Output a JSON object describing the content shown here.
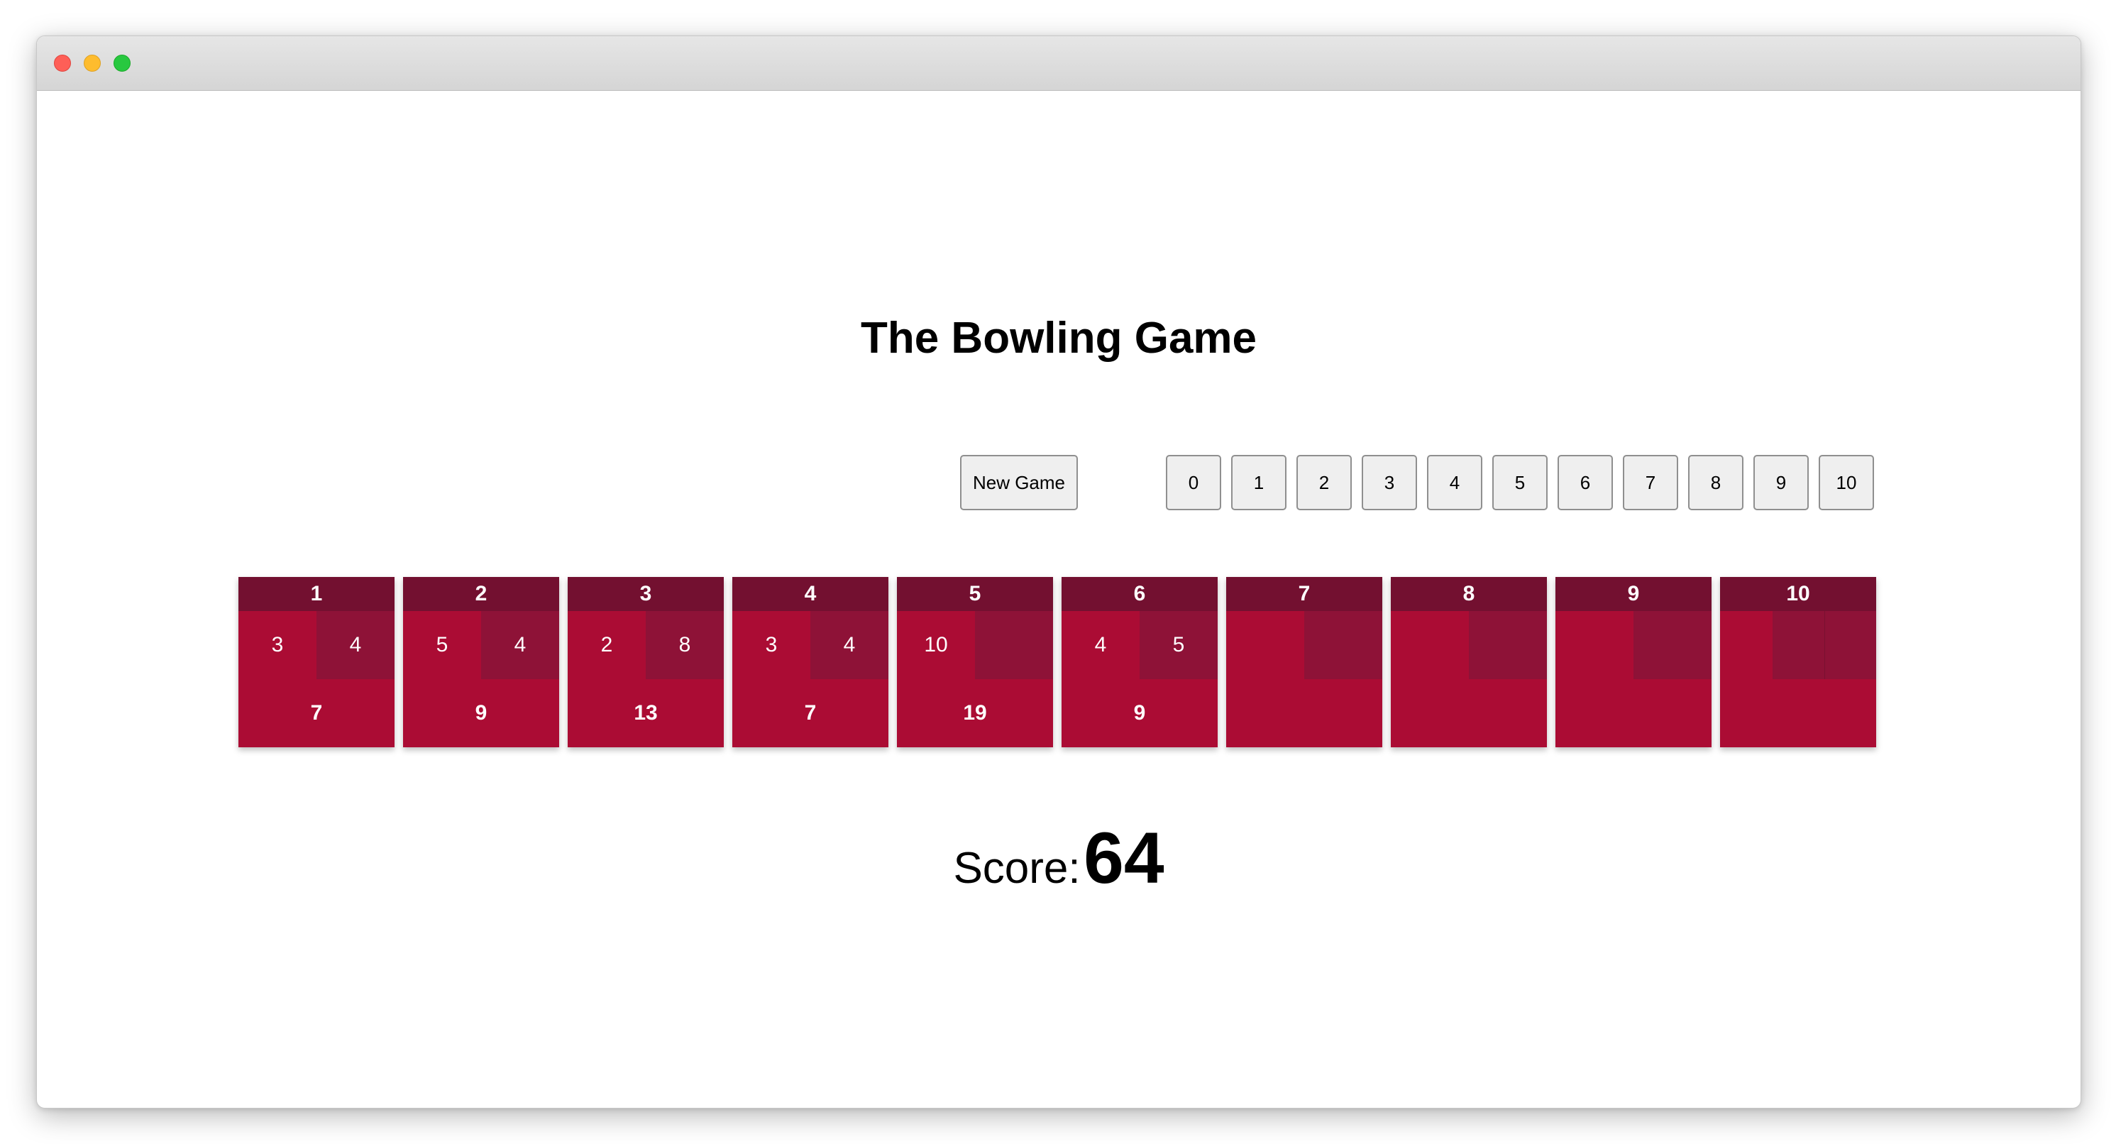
{
  "title": "The Bowling Game",
  "controls": {
    "new_game_label": "New Game",
    "pins": [
      "0",
      "1",
      "2",
      "3",
      "4",
      "5",
      "6",
      "7",
      "8",
      "9",
      "10"
    ]
  },
  "frames": [
    {
      "number": "1",
      "roll1": "3",
      "roll2": "4",
      "total": "7"
    },
    {
      "number": "2",
      "roll1": "5",
      "roll2": "4",
      "total": "9"
    },
    {
      "number": "3",
      "roll1": "2",
      "roll2": "8",
      "total": "13"
    },
    {
      "number": "4",
      "roll1": "3",
      "roll2": "4",
      "total": "7"
    },
    {
      "number": "5",
      "roll1": "10",
      "roll2": "",
      "total": "19"
    },
    {
      "number": "6",
      "roll1": "4",
      "roll2": "5",
      "total": "9"
    },
    {
      "number": "7",
      "roll1": "",
      "roll2": "",
      "total": ""
    },
    {
      "number": "8",
      "roll1": "",
      "roll2": "",
      "total": ""
    },
    {
      "number": "9",
      "roll1": "",
      "roll2": "",
      "total": ""
    },
    {
      "number": "10",
      "roll1": "",
      "roll2": "",
      "roll3": "",
      "total": ""
    }
  ],
  "score": {
    "label": "Score:",
    "value": "64"
  },
  "colors": {
    "frame_body": "#ab0c34",
    "frame_header": "#731030",
    "roll_box": "#8e1237"
  }
}
